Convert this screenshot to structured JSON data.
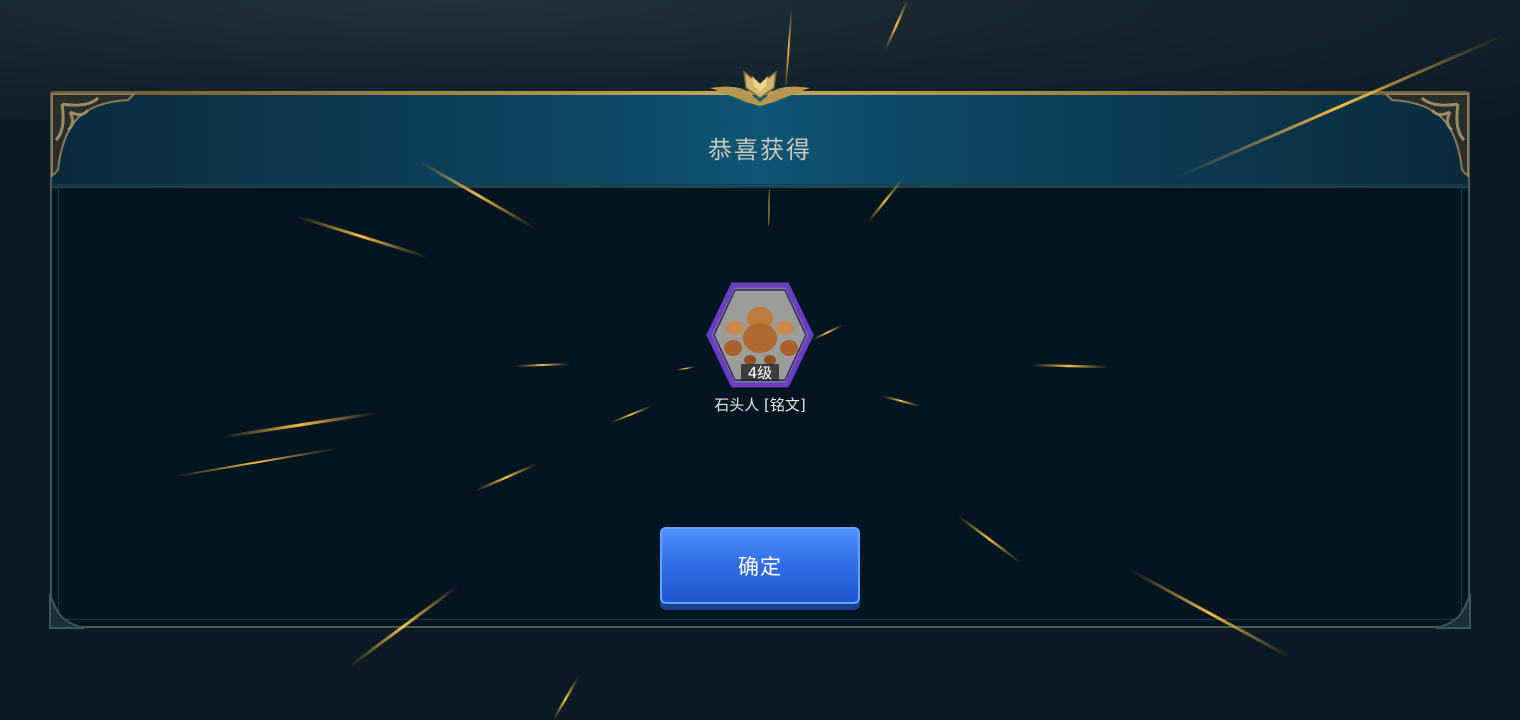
{
  "dialog": {
    "title": "恭喜获得",
    "confirm_label": "确定"
  },
  "reward": {
    "level": "4级",
    "name": "石头人 [铭文]",
    "icon": "stone-golem-icon",
    "frame_color": "#6a3cc4"
  },
  "colors": {
    "accent_gold": "#c9a85b",
    "button_blue": "#2e6ee8",
    "panel_bg": "#021520"
  }
}
